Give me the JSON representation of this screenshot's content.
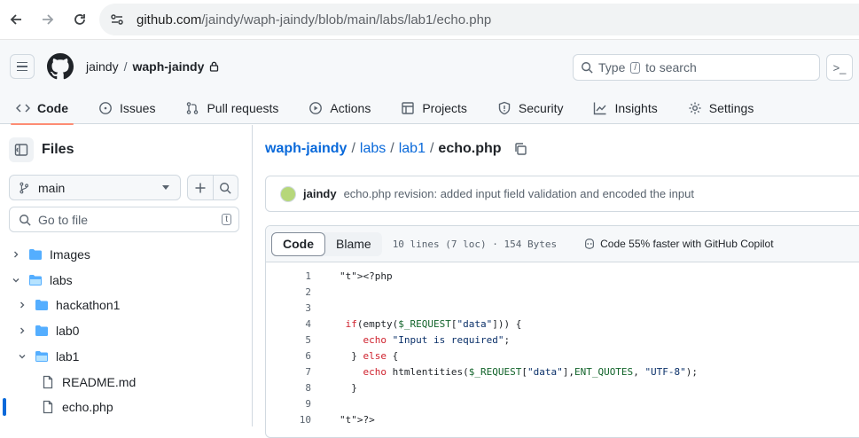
{
  "browser": {
    "url_host": "github.com",
    "url_path": "/jaindy/waph-jaindy/blob/main/labs/lab1/echo.php"
  },
  "header": {
    "owner": "jaindy",
    "separator": "/",
    "repo": "waph-jaindy",
    "search_prefix": "Type",
    "search_key": "/",
    "search_suffix": "to search",
    "command_label": ">_"
  },
  "tabs": [
    {
      "label": "Code",
      "icon": "code-icon"
    },
    {
      "label": "Issues",
      "icon": "issue-icon"
    },
    {
      "label": "Pull requests",
      "icon": "pull-request-icon"
    },
    {
      "label": "Actions",
      "icon": "play-icon"
    },
    {
      "label": "Projects",
      "icon": "table-icon"
    },
    {
      "label": "Security",
      "icon": "shield-icon"
    },
    {
      "label": "Insights",
      "icon": "graph-icon"
    },
    {
      "label": "Settings",
      "icon": "gear-icon"
    }
  ],
  "sidebar": {
    "title": "Files",
    "branch": "main",
    "goto_placeholder": "Go to file",
    "goto_key": "t",
    "tree": [
      {
        "label": "Images",
        "type": "folder",
        "expanded": false
      },
      {
        "label": "labs",
        "type": "folder",
        "expanded": true
      },
      {
        "label": "hackathon1",
        "type": "folder",
        "expanded": false
      },
      {
        "label": "lab0",
        "type": "folder",
        "expanded": false
      },
      {
        "label": "lab1",
        "type": "folder",
        "expanded": true
      },
      {
        "label": "README.md",
        "type": "file"
      },
      {
        "label": "echo.php",
        "type": "file",
        "selected": true
      }
    ]
  },
  "main": {
    "path": {
      "repo": "waph-jaindy",
      "dir1": "labs",
      "dir2": "lab1",
      "file": "echo.php",
      "sep": "/"
    },
    "commit": {
      "author": "jaindy",
      "message": "echo.php revision: added input field validation and encoded the input"
    },
    "file": {
      "code_tab": "Code",
      "blame_tab": "Blame",
      "info": "10 lines (7 loc) · 154 Bytes",
      "copilot": "Code 55% faster with GitHub Copilot",
      "lines": [
        {
          "n": "1",
          "text": "<?php"
        },
        {
          "n": "2",
          "text": ""
        },
        {
          "n": "3",
          "text": ""
        },
        {
          "n": "4",
          "text": " if(empty($_REQUEST[\"data\"])) {"
        },
        {
          "n": "5",
          "text": "    echo \"Input is required\";"
        },
        {
          "n": "6",
          "text": "  } else {"
        },
        {
          "n": "7",
          "text": "    echo htmlentities($_REQUEST[\"data\"],ENT_QUOTES, \"UTF-8\");"
        },
        {
          "n": "8",
          "text": "  }"
        },
        {
          "n": "9",
          "text": ""
        },
        {
          "n": "10",
          "text": "?>"
        }
      ]
    }
  },
  "colors": {
    "link": "#0969da",
    "active_tab_underline": "#fd8c73",
    "folder": "#54aeff"
  }
}
